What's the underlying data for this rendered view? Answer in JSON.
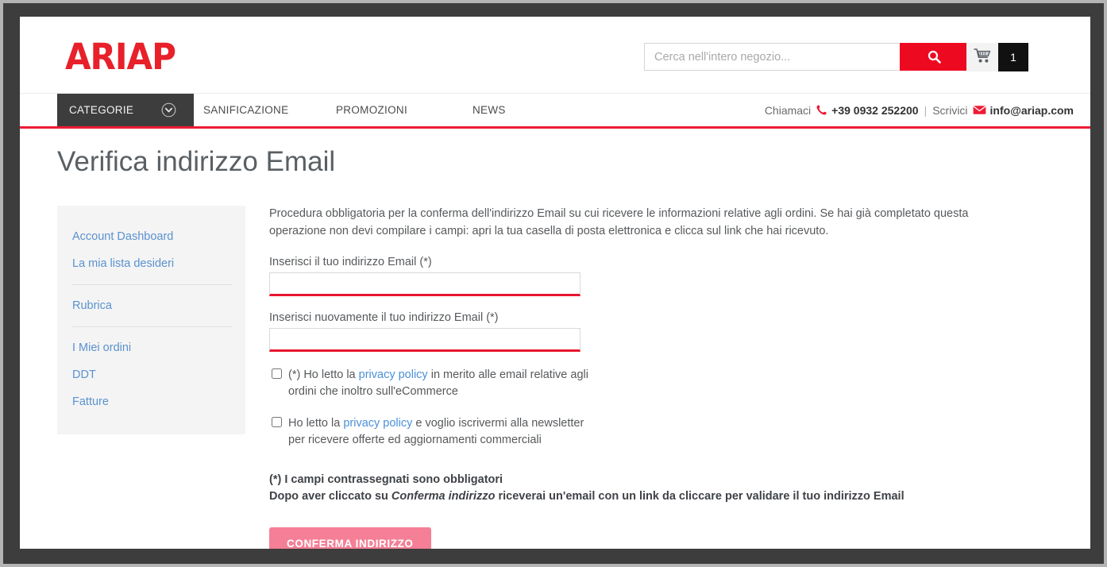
{
  "brand": {
    "logo_text": "ARIAP",
    "accent_red": "#ed0a21",
    "nav_dark": "#3d3d3d",
    "link_blue": "#5a92cf",
    "button_pink": "#f57f96"
  },
  "header": {
    "search": {
      "placeholder": "Cerca nell'intero negozio...",
      "value": "",
      "icon": "search-icon"
    },
    "cart": {
      "icon": "shopping-cart-icon",
      "count": "1"
    }
  },
  "nav": {
    "categories_label": "CATEGORIE",
    "categories_icon": "chevron-down-circle-icon",
    "links": [
      {
        "label": "SANIFICAZIONE"
      },
      {
        "label": "PROMOZIONI"
      },
      {
        "label": "NEWS"
      }
    ],
    "contact": {
      "call_label": "Chiamaci",
      "phone_icon": "phone-icon",
      "phone": "+39 0932 252200",
      "separator": "|",
      "write_label": "Scrivici",
      "email_icon": "envelope-icon",
      "email": "info@ariap.com"
    }
  },
  "page": {
    "title": "Verifica indirizzo Email"
  },
  "sidebar": {
    "groups": [
      {
        "items": [
          {
            "label": "Account Dashboard"
          },
          {
            "label": "La mia lista desideri"
          }
        ]
      },
      {
        "items": [
          {
            "label": "Rubrica"
          }
        ]
      },
      {
        "items": [
          {
            "label": "I Miei ordini"
          },
          {
            "label": "DDT"
          },
          {
            "label": "Fatture"
          }
        ]
      }
    ]
  },
  "form": {
    "intro": "Procedura obbligatoria per la conferma dell'indirizzo Email su cui ricevere le informazioni relative agli ordini. Se hai già completato questa operazione non devi compilare i campi: apri la tua casella di posta elettronica e clicca sul link che hai ricevuto.",
    "email_label": "Inserisci il tuo indirizzo Email (*)",
    "email_value": "",
    "email_confirm_label": "Inserisci nuovamente il tuo indirizzo Email (*)",
    "email_confirm_value": "",
    "checkbox_privacy": {
      "checked": false,
      "text_before": "(*) Ho letto la ",
      "link": "privacy policy",
      "text_after": " in merito alle email relative agli ordini che inoltro sull'eCommerce"
    },
    "checkbox_newsletter": {
      "checked": false,
      "text_before": "Ho letto la ",
      "link": "privacy policy",
      "text_after": " e voglio iscrivermi alla newsletter per ricevere offerte ed aggiornamenti commerciali"
    },
    "required_note_line1": "(*) I campi contrassegnati sono obbligatori",
    "required_note_line2_before": "Dopo aver cliccato su ",
    "required_note_emphasis": "Conferma indirizzo",
    "required_note_line2_after": " riceverai un'email con un link da cliccare per validare il tuo indirizzo Email",
    "submit_label": "CONFERMA INDIRIZZO"
  }
}
